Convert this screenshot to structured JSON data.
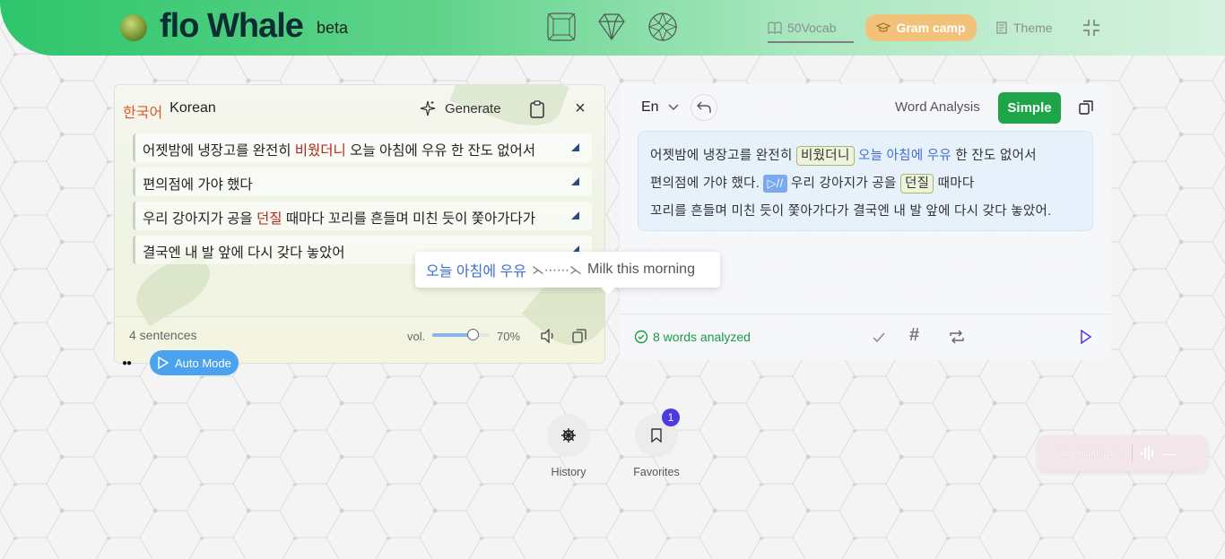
{
  "header": {
    "logo_text": "flo Whale",
    "beta": "beta",
    "vocab_label": "50Vocab",
    "gram_label": "Gram camp",
    "theme_label": "Theme"
  },
  "source_panel": {
    "language_native": "한국어",
    "language_name": "Korean",
    "generate_label": "Generate",
    "sentences": [
      {
        "before": "어젯밤에 냉장고를 완전히 ",
        "highlight": "비웠더니",
        "after": " 오늘 아침에 우유 한 잔도 없어서"
      },
      {
        "before": "편의점에 가야 했다",
        "highlight": "",
        "after": ""
      },
      {
        "before": "우리 강아지가 공을 ",
        "highlight": "던질",
        "after": " 때마다 꼬리를 흔들며 미친 듯이 쫓아가다가"
      },
      {
        "before": "결국엔 내 발 앞에 다시 갖다 놓았어",
        "highlight": "",
        "after": ""
      }
    ],
    "sentence_count": "4 sentences",
    "volume_label": "vol.",
    "volume_percent": "70%",
    "volume_value": 0.7,
    "auto_mode_label": "Auto Mode"
  },
  "analysis_panel": {
    "language": "En",
    "word_analysis_label": "Word Analysis",
    "simple_label": "Simple",
    "line1": {
      "a": "어젯밤에 냉장고를 완전히 ",
      "chip": "비웠더니",
      "blue": "오늘 아침에 우유",
      "b": " 한 잔도 없어서"
    },
    "line2": {
      "a": "편의점에 가야 했다. ",
      "play": "▷//",
      "b": "  우리 강아지가 공을 ",
      "chip": "던질",
      "c": " 때마다"
    },
    "line3": "꼬리를 흔들며 미친 듯이 쫓아가다가 결국엔 내 발 앞에 다시 갖다 놓았어.",
    "status": "8 words analyzed"
  },
  "tooltip": {
    "source": "오늘 아침에 우유",
    "arrow": "⋋⋯⋯⋋",
    "translation": "Milk this morning"
  },
  "bottom": {
    "history_label": "History",
    "favorites_label": "Favorites",
    "favorites_badge": "1"
  },
  "code_recognizer": {
    "label": "Code Recognizer...",
    "minimize": "—"
  },
  "colors": {
    "brand_green": "#1ea54a",
    "accent_blue": "#3f6fd4",
    "gram_orange": "#f2c27a",
    "badge_purple": "#4b3be0"
  }
}
